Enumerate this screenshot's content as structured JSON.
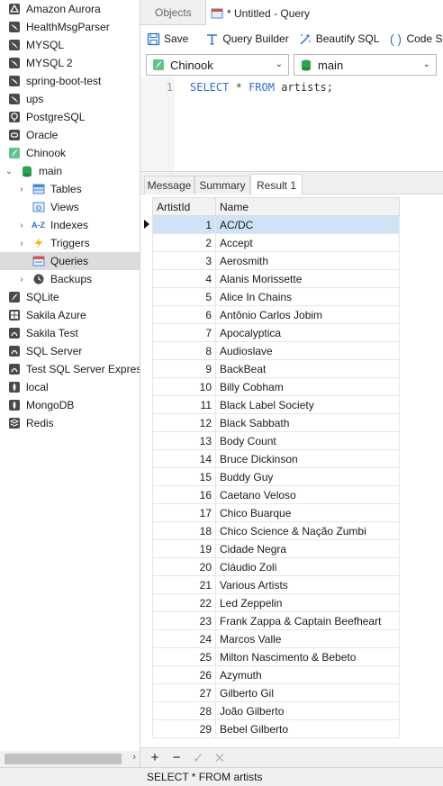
{
  "sidebar": {
    "connections": [
      {
        "label": "Amazon Aurora",
        "icon": "amazon-aurora-icon"
      },
      {
        "label": "HealthMsgParser",
        "icon": "mysql-dolphin-icon"
      },
      {
        "label": "MYSQL",
        "icon": "mysql-dolphin-icon"
      },
      {
        "label": "MYSQL 2",
        "icon": "mysql-dolphin-icon"
      },
      {
        "label": "spring-boot-test",
        "icon": "mysql-dolphin-icon"
      },
      {
        "label": "ups",
        "icon": "mysql-dolphin-icon"
      },
      {
        "label": "PostgreSQL",
        "icon": "postgresql-elephant-icon"
      },
      {
        "label": "Oracle",
        "icon": "oracle-icon"
      },
      {
        "label": "Chinook",
        "icon": "sqlite-feather-icon"
      },
      {
        "label": "main",
        "icon": "database-icon"
      },
      {
        "label": "Tables",
        "icon": "table-icon"
      },
      {
        "label": "Views",
        "icon": "view-icon"
      },
      {
        "label": "Indexes",
        "icon": "index-icon"
      },
      {
        "label": "Triggers",
        "icon": "trigger-lightning-icon"
      },
      {
        "label": "Queries",
        "icon": "query-icon"
      },
      {
        "label": "Backups",
        "icon": "backup-icon"
      },
      {
        "label": "SQLite",
        "icon": "sqlite-feather-icon"
      },
      {
        "label": "Sakila Azure",
        "icon": "sqlserver-icon"
      },
      {
        "label": "Sakila Test",
        "icon": "sqlserver-icon"
      },
      {
        "label": "SQL Server",
        "icon": "sqlserver-icon"
      },
      {
        "label": "Test SQL Server Express",
        "icon": "sqlserver-icon"
      },
      {
        "label": "local",
        "icon": "mongodb-leaf-icon"
      },
      {
        "label": "MongoDB",
        "icon": "mongodb-leaf-icon"
      },
      {
        "label": "Redis",
        "icon": "redis-icon"
      }
    ]
  },
  "tabs": {
    "objects": "Objects",
    "query": "* Untitled - Query"
  },
  "toolbar": {
    "save": "Save",
    "query_builder": "Query Builder",
    "beautify": "Beautify SQL",
    "code_snippet": "Code Sni"
  },
  "selects": {
    "connection": "Chinook",
    "database": "main"
  },
  "editor": {
    "line_number": "1",
    "kw_select": "SELECT",
    "star": "*",
    "kw_from": "FROM",
    "table": "artists;"
  },
  "result_tabs": {
    "message": "Message",
    "summary": "Summary",
    "result": "Result 1"
  },
  "grid": {
    "columns": [
      "ArtistId",
      "Name"
    ],
    "rows": [
      [
        "1",
        "AC/DC"
      ],
      [
        "2",
        "Accept"
      ],
      [
        "3",
        "Aerosmith"
      ],
      [
        "4",
        "Alanis Morissette"
      ],
      [
        "5",
        "Alice In Chains"
      ],
      [
        "6",
        "Antônio Carlos Jobim"
      ],
      [
        "7",
        "Apocalyptica"
      ],
      [
        "8",
        "Audioslave"
      ],
      [
        "9",
        "BackBeat"
      ],
      [
        "10",
        "Billy Cobham"
      ],
      [
        "11",
        "Black Label Society"
      ],
      [
        "12",
        "Black Sabbath"
      ],
      [
        "13",
        "Body Count"
      ],
      [
        "14",
        "Bruce Dickinson"
      ],
      [
        "15",
        "Buddy Guy"
      ],
      [
        "16",
        "Caetano Veloso"
      ],
      [
        "17",
        "Chico Buarque"
      ],
      [
        "18",
        "Chico Science & Nação Zumbi"
      ],
      [
        "19",
        "Cidade Negra"
      ],
      [
        "20",
        "Cláudio Zoli"
      ],
      [
        "21",
        "Various Artists"
      ],
      [
        "22",
        "Led Zeppelin"
      ],
      [
        "23",
        "Frank Zappa & Captain Beefheart"
      ],
      [
        "24",
        "Marcos Valle"
      ],
      [
        "25",
        "Milton Nascimento & Bebeto"
      ],
      [
        "26",
        "Azymuth"
      ],
      [
        "27",
        "Gilberto Gil"
      ],
      [
        "28",
        "João Gilberto"
      ],
      [
        "29",
        "Bebel Gilberto"
      ]
    ]
  },
  "gridbar": {
    "add": "+",
    "remove": "−",
    "apply": "✓",
    "discard": "✕"
  },
  "status": {
    "text": "SELECT * FROM artists"
  }
}
